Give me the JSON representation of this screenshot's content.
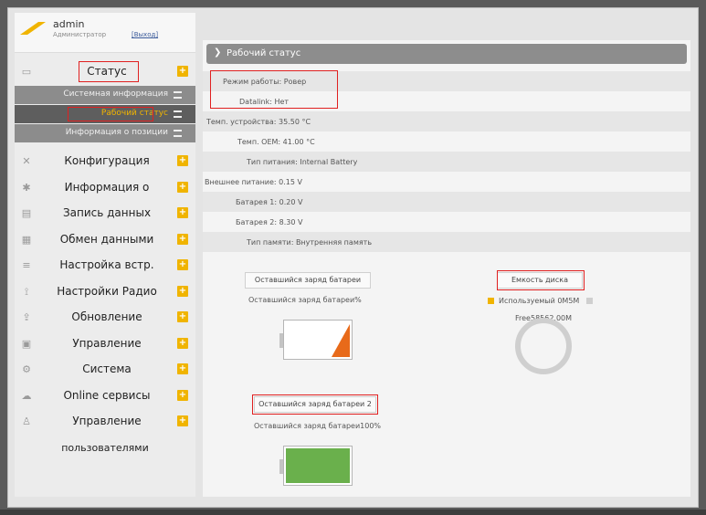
{
  "user": {
    "name": "admin",
    "role": "Администратор",
    "logout": "[Выход]"
  },
  "menu": {
    "status": "Статус",
    "sub_system_info": "Системная информация",
    "sub_work_status": "Рабочий статус",
    "sub_position_info": "Информация о позиции",
    "config": "Конфигурация",
    "info": "Информация о",
    "data_record": "Запись данных",
    "data_exchange": "Обмен данными",
    "builtin_settings": "Настройка встр.",
    "radio_settings": "Настройки Радио",
    "update": "Обновление",
    "management": "Управление",
    "system": "Система",
    "online_services": "Online сервисы",
    "user_management_1": "Управление",
    "user_management_2": "пользователями"
  },
  "main": {
    "title": "Рабочий статус",
    "rows": {
      "mode": "Режим работы: Ровер",
      "datalink": "Datalink: Нет",
      "device_temp": "Темп. устройства: 35.50 °C",
      "oem_temp": "Темп. OEM: 41.00 °C",
      "power_type": "Тип питания: Internal Battery",
      "ext_power": "Внешнее питание: 0.15 V",
      "battery1": "Батарея 1: 0.20 V",
      "battery2": "Батарея 2: 8.30 V",
      "storage_type": "Тип памяти: Внутренняя память"
    },
    "battery_panel": {
      "button1": "Оставшийся заряд батареи",
      "caption1": "Оставшийся заряд батареи%",
      "level1_percent": 0,
      "button2": "Оставшийся заряд батареи 2",
      "caption2": "Оставшийся заряд батареи100%",
      "level2_percent": 100
    },
    "disk_panel": {
      "button": "Емкость диска",
      "legend_used": "Используемый 0M5M",
      "free": "Free58562.00M"
    }
  },
  "colors": {
    "highlight": "#e02020",
    "accent": "#f0b400",
    "battery_green": "#6ab04c",
    "battery_low": "#e86a1a"
  }
}
